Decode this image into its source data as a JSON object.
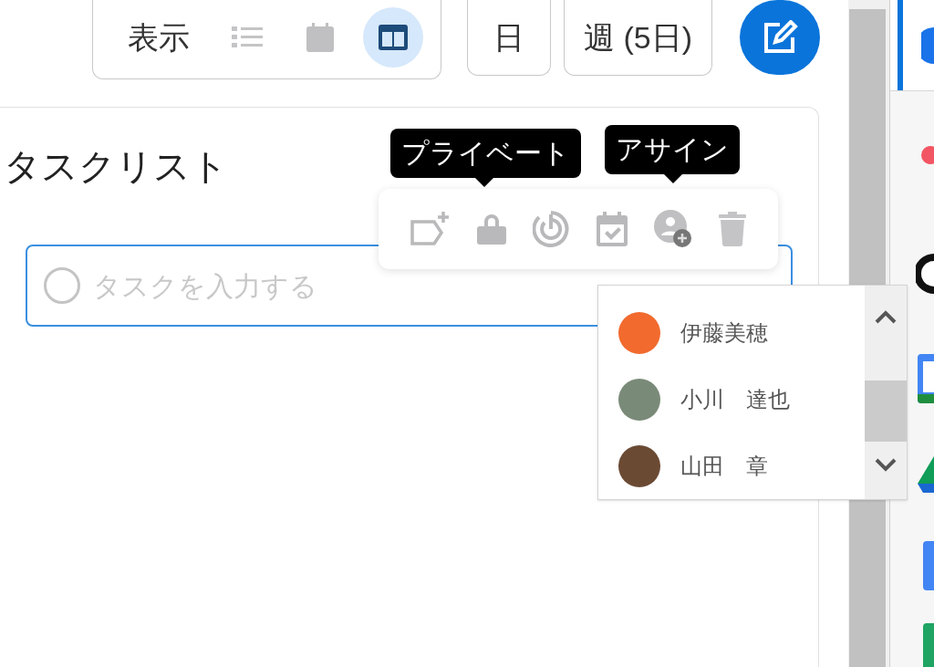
{
  "view_switcher": {
    "label": "表示",
    "modes": [
      {
        "kind": "list",
        "selected": false
      },
      {
        "kind": "calendar",
        "selected": false
      },
      {
        "kind": "board",
        "selected": true
      }
    ]
  },
  "range_buttons": [
    {
      "label": "日"
    },
    {
      "label": "週 (5日)"
    }
  ],
  "panel": {
    "title": "タスクリスト",
    "task_input": {
      "placeholder": "タスクを入力する"
    }
  },
  "task_toolbar": {
    "actions": [
      {
        "kind": "add-label"
      },
      {
        "kind": "lock",
        "tooltip": "プライベート"
      },
      {
        "kind": "priority"
      },
      {
        "kind": "due-date"
      },
      {
        "kind": "assign",
        "tooltip": "アサイン"
      },
      {
        "kind": "delete"
      }
    ]
  },
  "assignee_menu": {
    "people": [
      {
        "name": "伊藤美穂",
        "color": "#f26a2e"
      },
      {
        "name": "小川　達也",
        "color": "#7a8a78"
      },
      {
        "name": "山田　章",
        "color": "#6b4a34"
      }
    ]
  },
  "app_bar": {
    "items": [
      {
        "kind": "blue-circle",
        "selected": true
      },
      {
        "kind": "red-dot",
        "selected": false
      },
      {
        "kind": "dark-circle",
        "selected": false
      },
      {
        "kind": "blue-green-tile",
        "selected": false
      },
      {
        "kind": "triangle",
        "selected": false
      },
      {
        "kind": "blue-tile",
        "selected": false
      },
      {
        "kind": "green-tile",
        "selected": false
      }
    ]
  }
}
